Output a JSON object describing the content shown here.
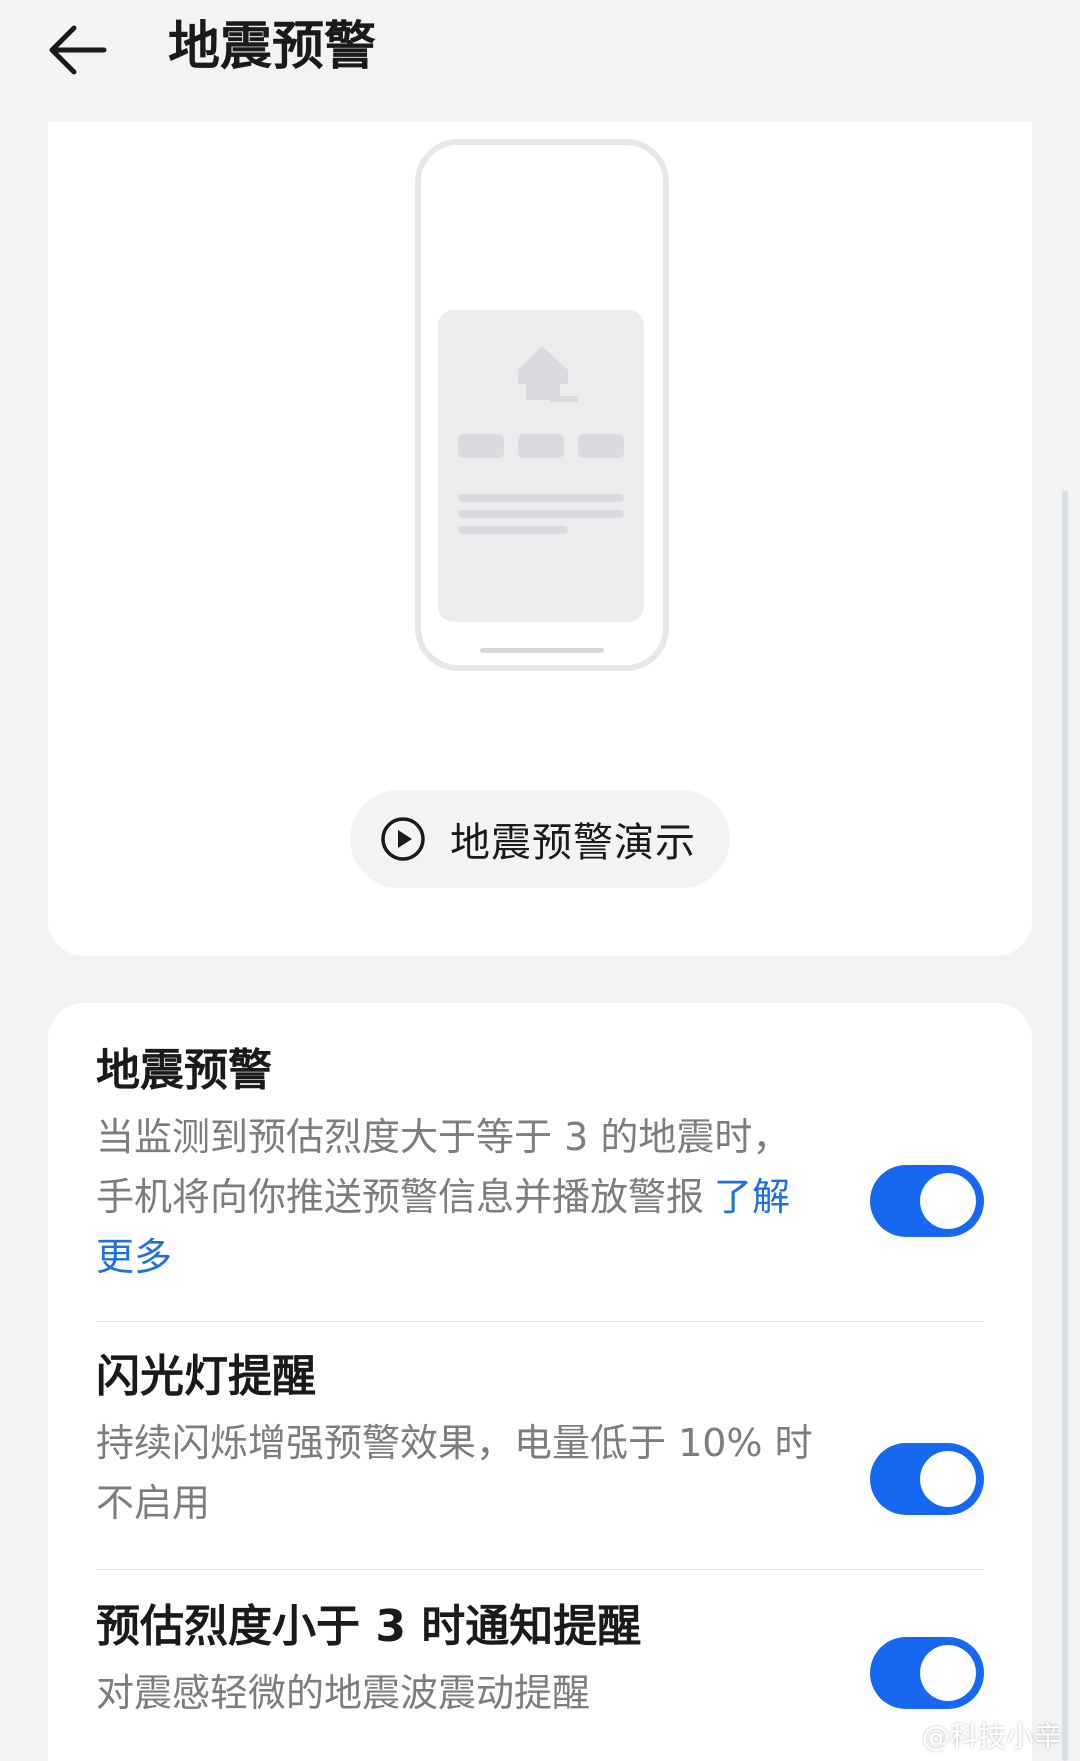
{
  "header": {
    "title": "地震预警",
    "back_icon": "arrow-left-icon"
  },
  "preview": {
    "illustration_icon": "phone-alert-illustration",
    "demo_button_label": "地震预警演示",
    "demo_icon": "play-circle-icon"
  },
  "settings": [
    {
      "title": "地震预警",
      "description": "当监测到预估烈度大于等于 3 的地震时，手机将向你推送预警信息并播放警报",
      "link_text": "了解更多",
      "enabled": true
    },
    {
      "title": "闪光灯提醒",
      "description": "持续闪烁增强预警效果，电量低于 10% 时不启用",
      "enabled": true
    },
    {
      "title": "预估烈度小于 3 时通知提醒",
      "description": "对震感轻微的地震波震动提醒",
      "enabled": true
    }
  ],
  "watermark": "@科技小辛",
  "colors": {
    "accent": "#1768f0",
    "link": "#1f6fe0",
    "background": "#f1f3f5",
    "card": "#ffffff"
  }
}
